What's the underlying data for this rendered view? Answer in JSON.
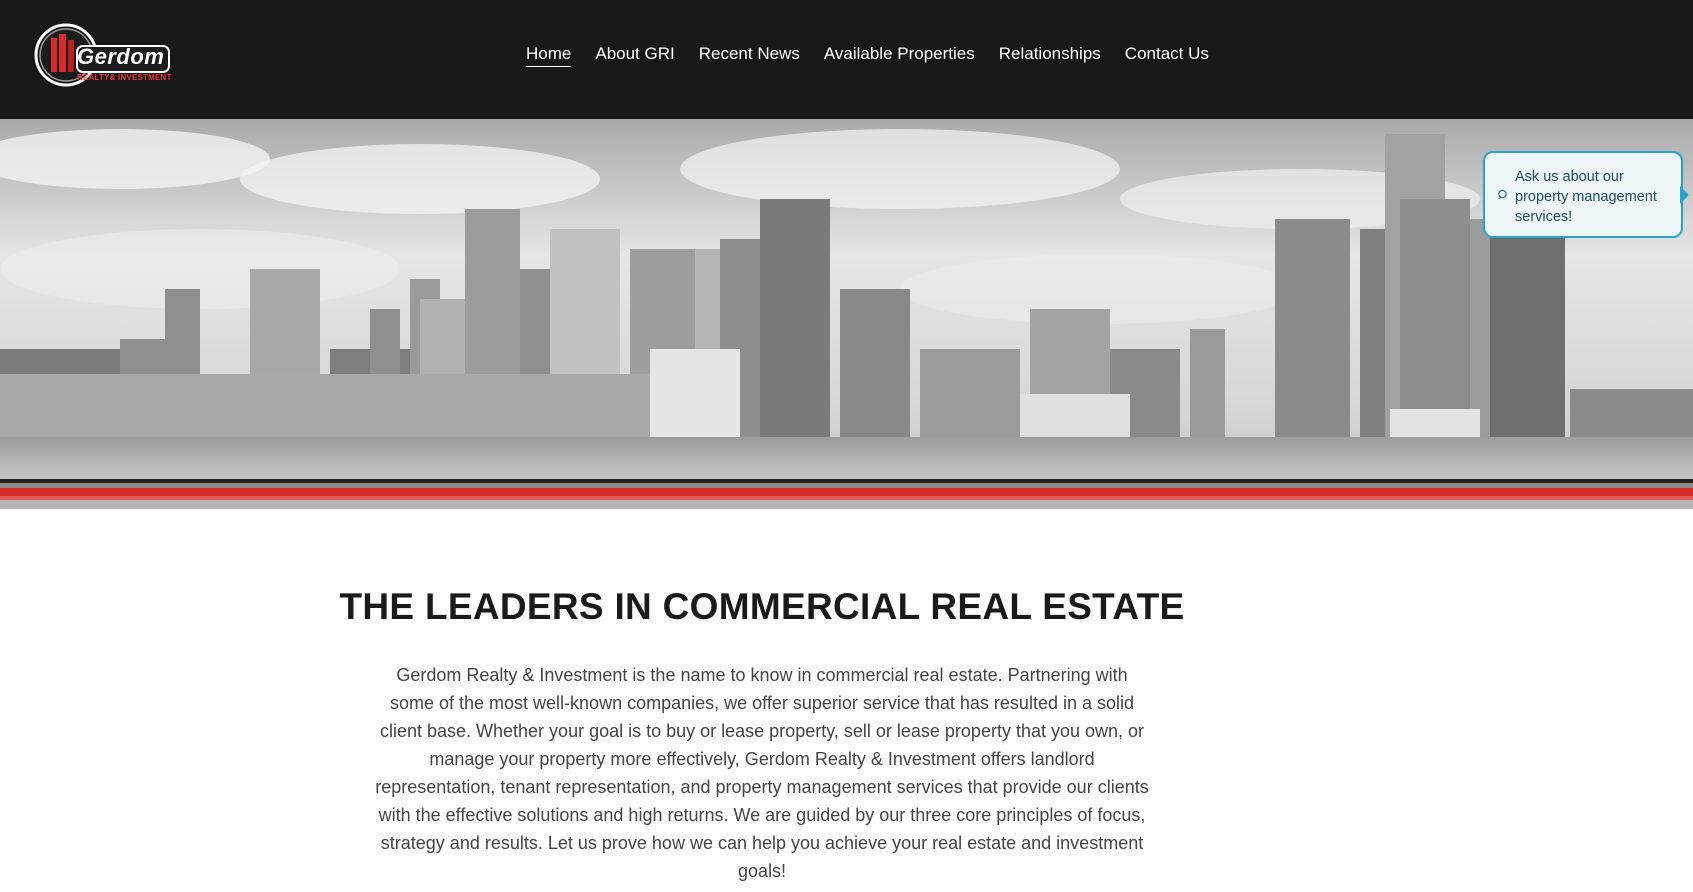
{
  "brand": {
    "name": "Gerdom",
    "tagline": "REALTY& INVESTMENT"
  },
  "nav": {
    "items": [
      {
        "label": "Home",
        "active": true
      },
      {
        "label": "About GRI",
        "active": false
      },
      {
        "label": "Recent News",
        "active": false
      },
      {
        "label": "Available Properties",
        "active": false
      },
      {
        "label": "Relationships",
        "active": false
      },
      {
        "label": "Contact Us",
        "active": false
      }
    ]
  },
  "hero": {
    "callout_text": "Ask us about our property management services!"
  },
  "main": {
    "title": "THE LEADERS IN COMMERCIAL REAL ESTATE",
    "body": "Gerdom Realty & Investment is the name to know in commercial real estate. Partnering with some of the most well-known companies, we offer superior service that has resulted in a solid client base. Whether your goal is to buy or lease property, sell or lease property that you own, or manage your property more effectively, Gerdom Realty & Investment offers landlord representation, tenant representation, and property management services that provide our clients with the effective solutions and high returns. We are guided by our three core principles of focus, strategy and results. Let us prove how we can help you achieve your real estate and investment goals!"
  },
  "colors": {
    "header_bg": "#181818",
    "accent_red": "#d92b2b",
    "callout_border": "#2aa3cc"
  }
}
